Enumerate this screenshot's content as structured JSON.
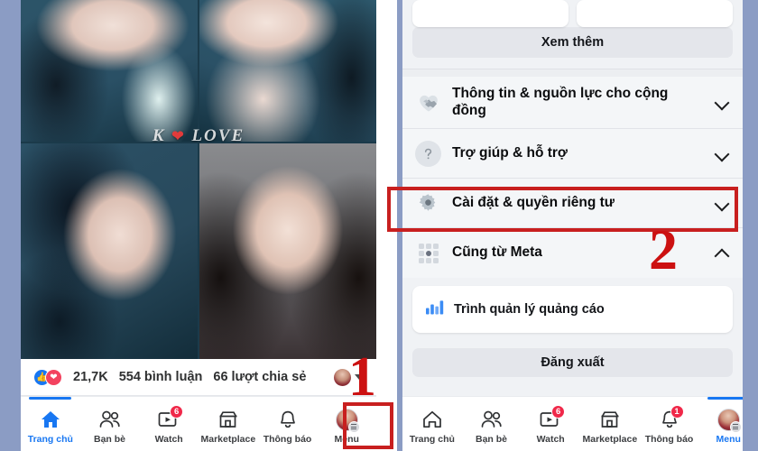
{
  "theme": {
    "frame_bg": "#8b9cc4",
    "accent_blue": "#1877f2",
    "marker_red": "#cc1111",
    "highlight_red": "#c81f1f",
    "panel_bg": "#f0f2f5"
  },
  "left_panel": {
    "watermark": {
      "prefix": "K",
      "heart": "❤",
      "suffix": "LOVE"
    },
    "post_stats": {
      "reaction_like_icon": "thumbs-up-icon",
      "reaction_love_icon": "heart-icon",
      "reaction_count": "21,7K",
      "comments": "554 bình luận",
      "shares": "66 lượt chia sẻ"
    },
    "tabbar": [
      {
        "label": "Trang chủ",
        "icon": "home-icon",
        "active": true,
        "badge": null
      },
      {
        "label": "Bạn bè",
        "icon": "friends-icon",
        "active": false,
        "badge": null
      },
      {
        "label": "Watch",
        "icon": "watch-icon",
        "active": false,
        "badge": "6"
      },
      {
        "label": "Marketplace",
        "icon": "marketplace-icon",
        "active": false,
        "badge": null
      },
      {
        "label": "Thông báo",
        "icon": "bell-icon",
        "active": false,
        "badge": null
      },
      {
        "label": "Menu",
        "icon": "avatar-menu-icon",
        "active": false,
        "badge": null
      }
    ],
    "step_marker": "1"
  },
  "right_panel": {
    "see_more_label": "Xem thêm",
    "menu_items": [
      {
        "label": "Thông tin & nguồn lực cho cộng đồng",
        "icon": "handshake-heart-icon",
        "chevron": "chevron-down-icon"
      },
      {
        "label": "Trợ giúp & hỗ trợ",
        "icon": "question-mark-icon",
        "chevron": "chevron-down-icon"
      },
      {
        "label": "Cài đặt & quyền riêng tư",
        "icon": "gear-icon",
        "chevron": "chevron-down-icon",
        "highlighted": true
      },
      {
        "label": "Cũng từ Meta",
        "icon": "meta-grid-icon",
        "chevron": "chevron-up-icon",
        "expanded": true
      }
    ],
    "ads_manager": {
      "label": "Trình quản lý quảng cáo",
      "icon": "bar-chart-icon"
    },
    "logout_label": "Đăng xuất",
    "tabbar": [
      {
        "label": "Trang chủ",
        "icon": "home-icon",
        "active": false,
        "badge": null
      },
      {
        "label": "Bạn bè",
        "icon": "friends-icon",
        "active": false,
        "badge": null
      },
      {
        "label": "Watch",
        "icon": "watch-icon",
        "active": false,
        "badge": "6"
      },
      {
        "label": "Marketplace",
        "icon": "marketplace-icon",
        "active": false,
        "badge": null
      },
      {
        "label": "Thông báo",
        "icon": "bell-icon",
        "active": false,
        "badge": "1"
      },
      {
        "label": "Menu",
        "icon": "avatar-menu-icon",
        "active": true,
        "badge": null
      }
    ],
    "step_marker": "2"
  }
}
